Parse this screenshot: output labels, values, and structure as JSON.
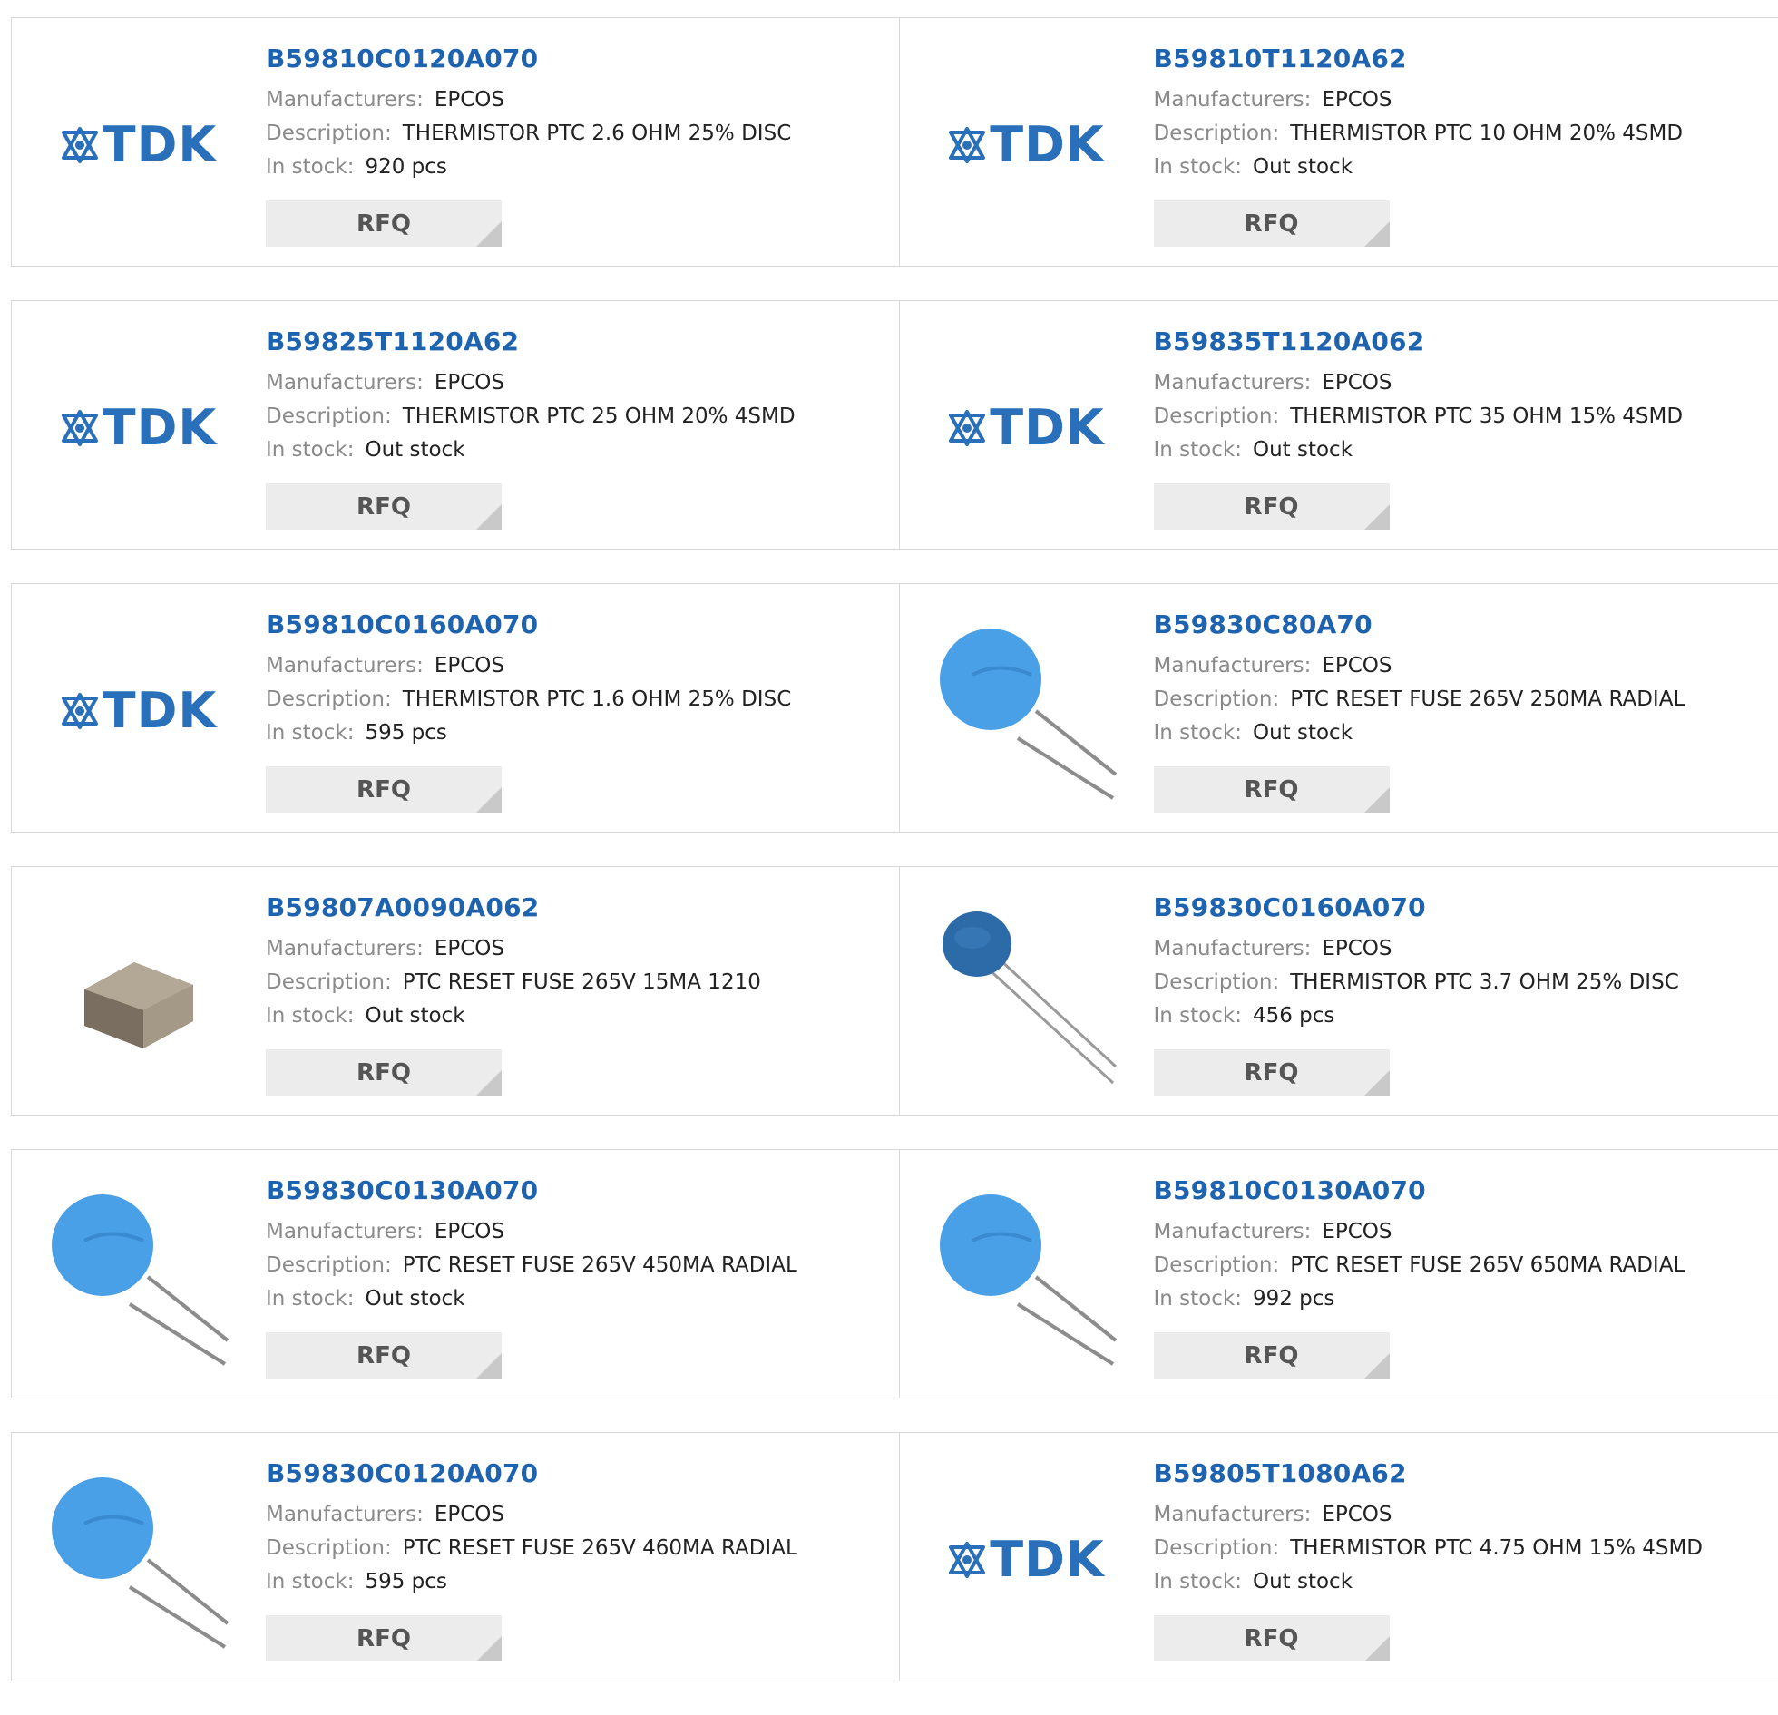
{
  "labels": {
    "manufacturers": "Manufacturers:",
    "description": "Description:",
    "in_stock": "In stock:",
    "rfq": "RFQ"
  },
  "colors": {
    "part_number": "#1e63b0",
    "tdk_blue": "#2a6fba",
    "button_bg": "#ececec"
  },
  "products": [
    {
      "part": "B59810C0120A070",
      "manufacturer": "EPCOS",
      "description": "THERMISTOR PTC 2.6 OHM 25% DISC",
      "stock": "920 pcs",
      "image": "tdk-logo",
      "logo_text": "TDK"
    },
    {
      "part": "B59810T1120A62",
      "manufacturer": "EPCOS",
      "description": "THERMISTOR PTC 10 OHM 20% 4SMD",
      "stock": "Out stock",
      "image": "tdk-logo",
      "logo_text": "TDK"
    },
    {
      "part": "B59825T1120A62",
      "manufacturer": "EPCOS",
      "description": "THERMISTOR PTC 25 OHM 20% 4SMD",
      "stock": "Out stock",
      "image": "tdk-logo",
      "logo_text": "TDK"
    },
    {
      "part": "B59835T1120A062",
      "manufacturer": "EPCOS",
      "description": "THERMISTOR PTC 35 OHM 15% 4SMD",
      "stock": "Out stock",
      "image": "tdk-logo",
      "logo_text": "TDK"
    },
    {
      "part": "B59810C0160A070",
      "manufacturer": "EPCOS",
      "description": "THERMISTOR PTC 1.6 OHM 25% DISC",
      "stock": "595 pcs",
      "image": "tdk-logo",
      "logo_text": "TDK"
    },
    {
      "part": "B59830C80A70",
      "manufacturer": "EPCOS",
      "description": "PTC RESET FUSE 265V 250MA RADIAL",
      "stock": "Out stock",
      "image": "radial-disc-light",
      "logo_text": ""
    },
    {
      "part": "B59807A0090A062",
      "manufacturer": "EPCOS",
      "description": "PTC RESET FUSE 265V 15MA 1210",
      "stock": "Out stock",
      "image": "smd-chip",
      "logo_text": ""
    },
    {
      "part": "B59830C0160A070",
      "manufacturer": "EPCOS",
      "description": "THERMISTOR PTC 3.7 OHM 25% DISC",
      "stock": "456 pcs",
      "image": "radial-disc-dark",
      "logo_text": ""
    },
    {
      "part": "B59830C0130A070",
      "manufacturer": "EPCOS",
      "description": "PTC RESET FUSE 265V 450MA RADIAL",
      "stock": "Out stock",
      "image": "radial-disc-light",
      "logo_text": ""
    },
    {
      "part": "B59810C0130A070",
      "manufacturer": "EPCOS",
      "description": "PTC RESET FUSE 265V 650MA RADIAL",
      "stock": "992 pcs",
      "image": "radial-disc-light",
      "logo_text": ""
    },
    {
      "part": "B59830C0120A070",
      "manufacturer": "EPCOS",
      "description": "PTC RESET FUSE 265V 460MA RADIAL",
      "stock": "595 pcs",
      "image": "radial-disc-light",
      "logo_text": ""
    },
    {
      "part": "B59805T1080A62",
      "manufacturer": "EPCOS",
      "description": "THERMISTOR PTC 4.75 OHM 15% 4SMD",
      "stock": "Out stock",
      "image": "tdk-logo",
      "logo_text": "TDK"
    }
  ]
}
